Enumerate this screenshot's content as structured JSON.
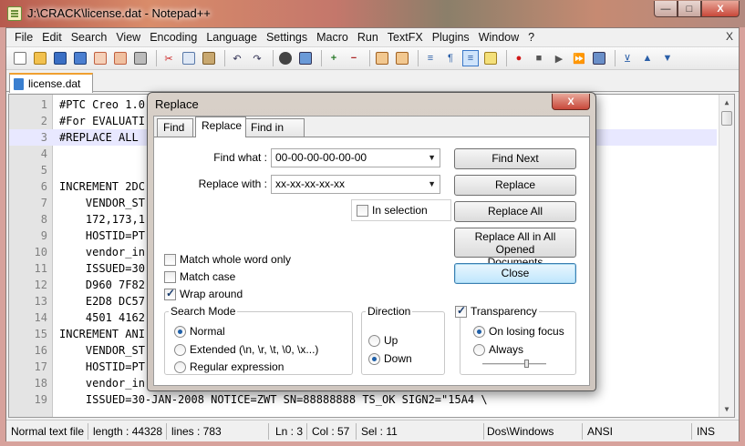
{
  "window": {
    "title": "J:\\CRACK\\license.dat - Notepad++",
    "controls": {
      "minimize": "—",
      "maximize": "□",
      "close": "X"
    }
  },
  "menu": [
    "File",
    "Edit",
    "Search",
    "View",
    "Encoding",
    "Language",
    "Settings",
    "Macro",
    "Run",
    "TextFX",
    "Plugins",
    "Window",
    "?"
  ],
  "menu_close": "X",
  "toolbar_icons": [
    "new-file-icon",
    "open-file-icon",
    "save-icon",
    "save-all-icon",
    "close-icon",
    "close-all-icon",
    "print-icon",
    "cut-icon",
    "copy-icon",
    "paste-icon",
    "undo-icon",
    "redo-icon",
    "find-icon",
    "replace-icon",
    "zoom-in-icon",
    "zoom-out-icon",
    "sync-v-icon",
    "sync-h-icon",
    "word-wrap-icon",
    "show-all-icon",
    "indent-guide-icon",
    "doc-map-icon",
    "record-macro-icon",
    "stop-macro-icon",
    "play-macro-icon",
    "run-macro-icon",
    "save-macro-icon",
    "trim-icon",
    "up-icon",
    "down-icon"
  ],
  "tab": {
    "label": "license.dat"
  },
  "editor": {
    "lines": [
      {
        "n": "1",
        "t": "#PTC Creo 1.0"
      },
      {
        "n": "2",
        "t": "#For EVALUATI"
      },
      {
        "n": "3",
        "t": "#REPLACE ALL"
      },
      {
        "n": "4",
        "t": ""
      },
      {
        "n": "5",
        "t": ""
      },
      {
        "n": "6",
        "t": "INCREMENT 2DC"
      },
      {
        "n": "7",
        "t": "    VENDOR_ST"
      },
      {
        "n": "8",
        "t": "    172,173,1"
      },
      {
        "n": "9",
        "t": "    HOSTID=PT"
      },
      {
        "n": "10",
        "t": "    vendor_in"
      },
      {
        "n": "11",
        "t": "    ISSUED=30"
      },
      {
        "n": "12",
        "t": "    D960 7F82"
      },
      {
        "n": "13",
        "t": "    E2D8 DC57"
      },
      {
        "n": "14",
        "t": "    4501 4162"
      },
      {
        "n": "15",
        "t": "INCREMENT ANI"
      },
      {
        "n": "16",
        "t": "    VENDOR_ST"
      },
      {
        "n": "17",
        "t": "    HOSTID=PT"
      },
      {
        "n": "18",
        "t": "    vendor_in"
      },
      {
        "n": "19",
        "t": "    ISSUED=30-JAN-2008 NOTICE=ZWT SN=88888888 TS_OK SIGN2=\"15A4 \\"
      }
    ],
    "current_line": 3
  },
  "status": {
    "type": "Normal text file",
    "length": "length : 44328",
    "lines": "lines : 783",
    "ln": "Ln : 3",
    "col": "Col : 57",
    "sel": "Sel : 11",
    "eol": "Dos\\Windows",
    "encoding": "ANSI",
    "mode": "INS"
  },
  "dialog": {
    "title": "Replace",
    "close": "X",
    "tabs": [
      "Find",
      "Replace",
      "Find in Files"
    ],
    "active_tab": "Replace",
    "find_label": "Find what :",
    "find_value": "00-00-00-00-00-00",
    "replace_label": "Replace with :",
    "replace_value": "xx-xx-xx-xx-xx",
    "buttons": {
      "find_next": "Find Next",
      "replace": "Replace",
      "replace_all": "Replace All",
      "replace_all_opened_1": "Replace All in All Opened",
      "replace_all_opened_2": "Documents",
      "close": "Close"
    },
    "in_selection": {
      "label": "In selection",
      "checked": false
    },
    "options": {
      "whole_word": {
        "label": "Match whole word only",
        "checked": false
      },
      "match_case": {
        "label": "Match case",
        "checked": false
      },
      "wrap_around": {
        "label": "Wrap around",
        "checked": true
      }
    },
    "search_mode": {
      "title": "Search Mode",
      "normal": "Normal",
      "extended": "Extended (\\n, \\r, \\t, \\0, \\x...)",
      "regex": "Regular expression",
      "selected": "Normal"
    },
    "direction": {
      "title": "Direction",
      "up": "Up",
      "down": "Down",
      "selected": "Down"
    },
    "transparency": {
      "label": "Transparency",
      "checked": true,
      "on_losing_focus": "On losing focus",
      "always": "Always",
      "selected": "On losing focus",
      "level": 0.7
    }
  }
}
